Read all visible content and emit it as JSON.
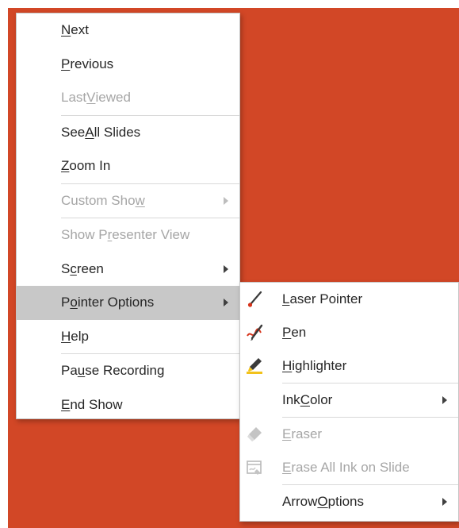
{
  "colors": {
    "slide_background": "#d24726",
    "menu_background": "#ffffff",
    "highlight": "#c8c8c8",
    "text": "#262626",
    "disabled_text": "#a6a6a6"
  },
  "main_menu": {
    "next": {
      "pre": "",
      "key": "N",
      "post": "ext"
    },
    "previous": {
      "pre": "",
      "key": "P",
      "post": "revious"
    },
    "last_viewed": {
      "pre": "Last ",
      "key": "V",
      "post": "iewed"
    },
    "see_all_slides": {
      "pre": "See ",
      "key": "A",
      "post": "ll Slides"
    },
    "zoom_in": {
      "pre": "",
      "key": "Z",
      "post": "oom In"
    },
    "custom_show": {
      "pre": "Custom Sho",
      "key": "w",
      "post": ""
    },
    "show_presenter_view": {
      "pre": "Show P",
      "key": "r",
      "post": "esenter View"
    },
    "screen": {
      "pre": "S",
      "key": "c",
      "post": "reen"
    },
    "pointer_options": {
      "pre": "P",
      "key": "o",
      "post": "inter Options"
    },
    "help": {
      "pre": "",
      "key": "H",
      "post": "elp"
    },
    "pause_recording": {
      "pre": "Pa",
      "key": "u",
      "post": "se Recording"
    },
    "end_show": {
      "pre": "",
      "key": "E",
      "post": "nd Show"
    }
  },
  "sub_menu": {
    "laser_pointer": {
      "pre": "",
      "key": "L",
      "post": "aser Pointer",
      "icon": "laser-pointer-icon"
    },
    "pen": {
      "pre": "",
      "key": "P",
      "post": "en",
      "icon": "pen-icon"
    },
    "highlighter": {
      "pre": "",
      "key": "H",
      "post": "ighlighter",
      "icon": "highlighter-icon"
    },
    "ink_color": {
      "pre": "Ink ",
      "key": "C",
      "post": "olor"
    },
    "eraser": {
      "pre": "",
      "key": "E",
      "post": "raser",
      "icon": "eraser-icon"
    },
    "erase_all_ink": {
      "pre": "",
      "key": "E",
      "post": "rase All Ink on Slide",
      "icon": "erase-all-ink-icon"
    },
    "arrow_options": {
      "pre": "Arrow ",
      "key": "O",
      "post": "ptions"
    }
  }
}
